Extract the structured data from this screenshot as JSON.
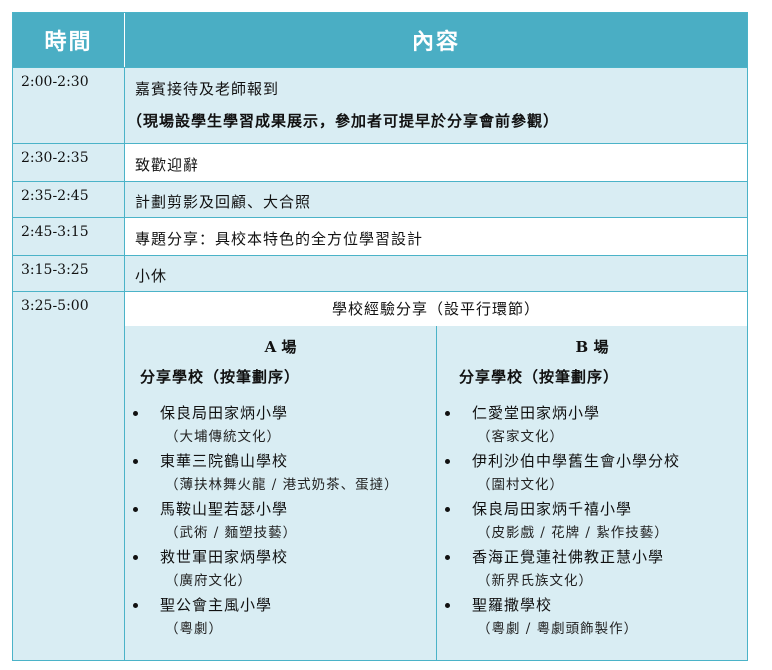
{
  "header": {
    "time": "時間",
    "content": "內容"
  },
  "rows": [
    {
      "time": "2:00-2:30",
      "lines": [
        "嘉賓接待及老師報到",
        "（現場設學生學習成果展示，參加者可提早於分享會前參觀）"
      ]
    },
    {
      "time": "2:30-2:35",
      "lines": [
        "致歡迎辭"
      ]
    },
    {
      "time": "2:35-2:45",
      "lines": [
        "計劃剪影及回顧、大合照"
      ]
    },
    {
      "time": "2:45-3:15",
      "lines": [
        "專題分享：具校本特色的全方位學習設計"
      ]
    },
    {
      "time": "3:15-3:25",
      "lines": [
        "小休"
      ]
    },
    {
      "time": "3:25-5:00",
      "title": "學校經驗分享（設平行環節）"
    }
  ],
  "venues": [
    {
      "title": "A 場",
      "subtitle": "分享學校（按筆劃序）",
      "schools": [
        {
          "name": "保良局田家炳小學",
          "note": "（大埔傳統文化）"
        },
        {
          "name": "東華三院鶴山學校",
          "note": "（薄扶林舞火龍 / 港式奶茶、蛋撻）"
        },
        {
          "name": "馬鞍山聖若瑟小學",
          "note": "（武術 / 麵塑技藝）"
        },
        {
          "name": "救世軍田家炳學校",
          "note": "（廣府文化）"
        },
        {
          "name": "聖公會主風小學",
          "note": "（粵劇）"
        }
      ]
    },
    {
      "title": "B 場",
      "subtitle": "分享學校（按筆劃序）",
      "schools": [
        {
          "name": "仁愛堂田家炳小學",
          "note": "（客家文化）"
        },
        {
          "name": "伊利沙伯中學舊生會小學分校",
          "note": "（圍村文化）"
        },
        {
          "name": "保良局田家炳千禧小學",
          "note": "（皮影戲 / 花牌 / 紥作技藝）"
        },
        {
          "name": "香海正覺蓮社佛教正慧小學",
          "note": "（新界氏族文化）"
        },
        {
          "name": "聖羅撒學校",
          "note": "（粵劇 / 粵劇頭飾製作）"
        }
      ]
    }
  ]
}
